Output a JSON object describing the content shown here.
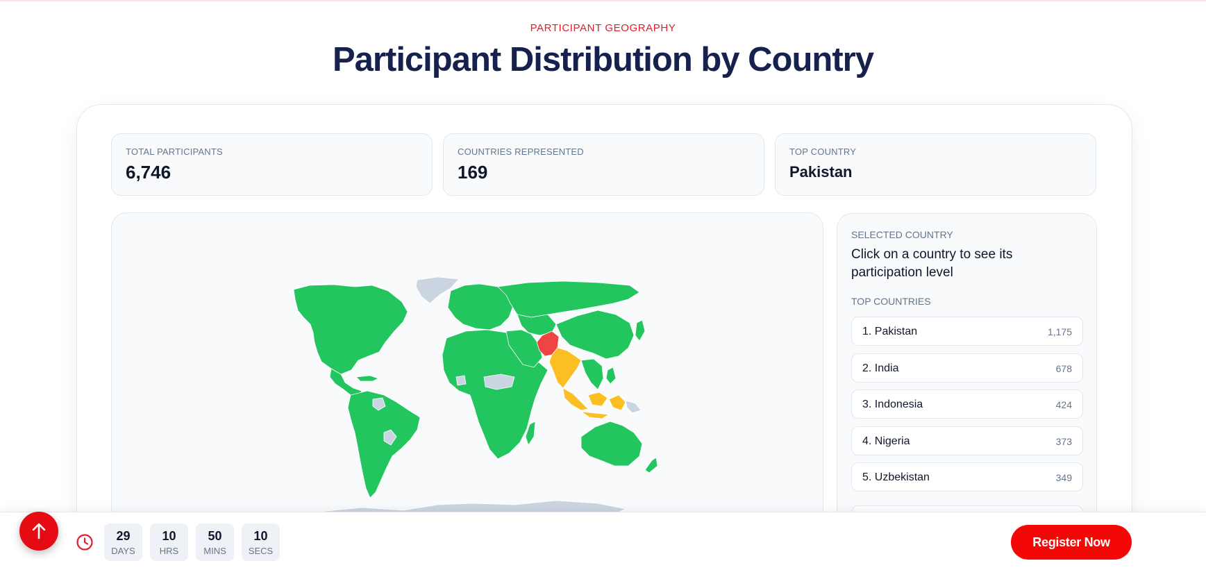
{
  "header": {
    "eyebrow": "PARTICIPANT GEOGRAPHY",
    "title": "Participant Distribution by Country"
  },
  "stats": [
    {
      "label": "TOTAL PARTICIPANTS",
      "value": "6,746"
    },
    {
      "label": "COUNTRIES REPRESENTED",
      "value": "169"
    },
    {
      "label": "TOP COUNTRY",
      "value": "Pakistan"
    }
  ],
  "map": {
    "legend_colors": {
      "highest": "#ef4444",
      "high": "#fbbf24",
      "participating": "#22c55e",
      "none": "#cbd5e1"
    },
    "highlighted": {
      "highest": [
        "Pakistan"
      ],
      "high": [
        "India",
        "Indonesia"
      ]
    }
  },
  "sidebar": {
    "selected_label": "SELECTED COUNTRY",
    "selected_text": "Click on a country to see its participation level",
    "top_label": "TOP COUNTRIES",
    "countries": [
      {
        "name": "1. Pakistan",
        "count": "1,175"
      },
      {
        "name": "2. India",
        "count": "678"
      },
      {
        "name": "3. Indonesia",
        "count": "424"
      },
      {
        "name": "4. Nigeria",
        "count": "373"
      },
      {
        "name": "5. Uzbekistan",
        "count": "349"
      }
    ]
  },
  "countdown": [
    {
      "value": "29",
      "unit": "DAYS"
    },
    {
      "value": "10",
      "unit": "HRS"
    },
    {
      "value": "50",
      "unit": "MINS"
    },
    {
      "value": "10",
      "unit": "SECS"
    }
  ],
  "actions": {
    "register": "Register Now"
  },
  "icons": {
    "scroll_top": "arrow-up-icon",
    "timer": "clock-icon"
  }
}
